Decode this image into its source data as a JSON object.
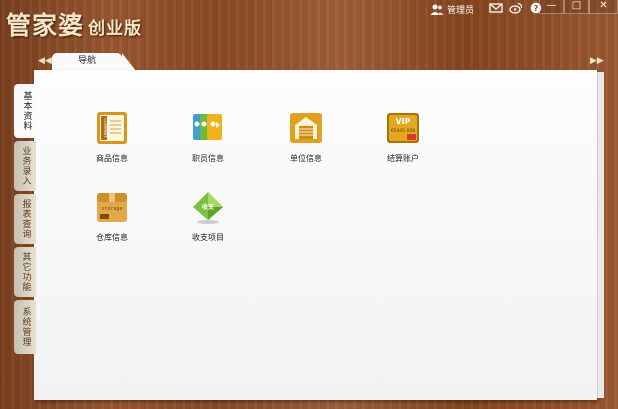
{
  "app": {
    "title": "管家婆",
    "edition": "创业版"
  },
  "titlebar": {
    "user_label": "管理员",
    "icons": [
      "user-icon",
      "mail-icon",
      "weibo-icon",
      "help-icon"
    ],
    "window_buttons": [
      "minimize",
      "maximize",
      "close"
    ],
    "window_glyphs": [
      "—",
      "□",
      "✕"
    ]
  },
  "nav": {
    "tab_label": "导航",
    "left_arrow": "◀◀",
    "right_arrow": "▶▶"
  },
  "sidebar": {
    "tabs": [
      {
        "label": "基本资料",
        "active": true
      },
      {
        "label": "业务录入",
        "active": false
      },
      {
        "label": "报表查询",
        "active": false
      },
      {
        "label": "其它功能",
        "active": false
      },
      {
        "label": "系统管理",
        "active": false
      }
    ]
  },
  "main": {
    "items": [
      {
        "label": "商品信息",
        "icon": "company-book-icon",
        "icon_text": "COMPANY"
      },
      {
        "label": "职员信息",
        "icon": "employee-cards-icon"
      },
      {
        "label": "单位信息",
        "icon": "warehouse-door-icon"
      },
      {
        "label": "结算账户",
        "icon": "vip-card-icon",
        "icon_text": "VIP",
        "icon_number": "65445 028"
      },
      {
        "label": "仓库信息",
        "icon": "storage-box-icon",
        "icon_text": "storage"
      },
      {
        "label": "收支项目",
        "icon": "income-expense-diamond-icon",
        "icon_text": "收支"
      }
    ]
  },
  "colors": {
    "wood": "#8a4a26",
    "panel": "#fafafa",
    "gold": "#e0a020",
    "green": "#7cc040"
  }
}
